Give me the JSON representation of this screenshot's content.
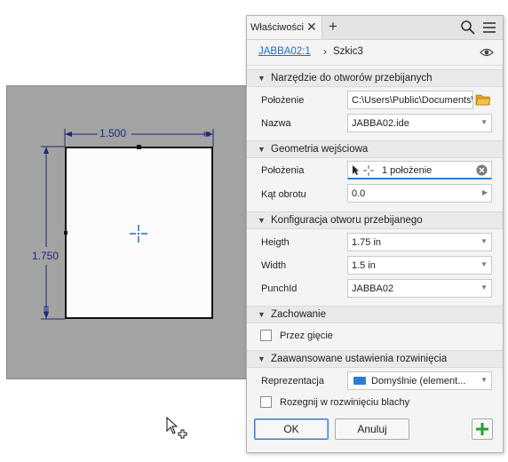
{
  "canvas": {
    "width_dim": "1.500",
    "height_dim": "1.750"
  },
  "panel": {
    "tab_label": "Właściwości",
    "breadcrumb": {
      "link": "JABBA02:1",
      "current": "Szkic3"
    },
    "sections": {
      "tool": {
        "title": "Narzędzie do otworów przebijanych",
        "location_label": "Położenie",
        "location_value": "C:\\Users\\Public\\Documents\\",
        "name_label": "Nazwa",
        "name_value": "JABBA02.ide"
      },
      "geometry": {
        "title": "Geometria wejściowa",
        "positions_label": "Położenia",
        "positions_value": "1 położenie",
        "angle_label": "Kąt obrotu",
        "angle_value": "0.0"
      },
      "config": {
        "title": "Konfiguracja otworu przebijanego",
        "height_label": "Heigth",
        "height_value": "1.75 in",
        "width_label": "Width",
        "width_value": "1.5 in",
        "punchid_label": "PunchId",
        "punchid_value": "JABBA02"
      },
      "behavior": {
        "title": "Zachowanie",
        "through_bend_label": "Przez gięcie",
        "through_bend_checked": false
      },
      "unfold": {
        "title": "Zaawansowane ustawienia rozwinięcia",
        "representation_label": "Reprezentacja",
        "representation_value": "Domyślnie (element...",
        "unfold_label": "Rozegnij w rozwinięciu blachy",
        "unfold_checked": false
      }
    },
    "buttons": {
      "ok": "OK",
      "cancel": "Anuluj"
    },
    "colors": {
      "accent": "#2a7fd4",
      "add_green": "#2e9b3a",
      "folder": "#e3a21a"
    }
  }
}
